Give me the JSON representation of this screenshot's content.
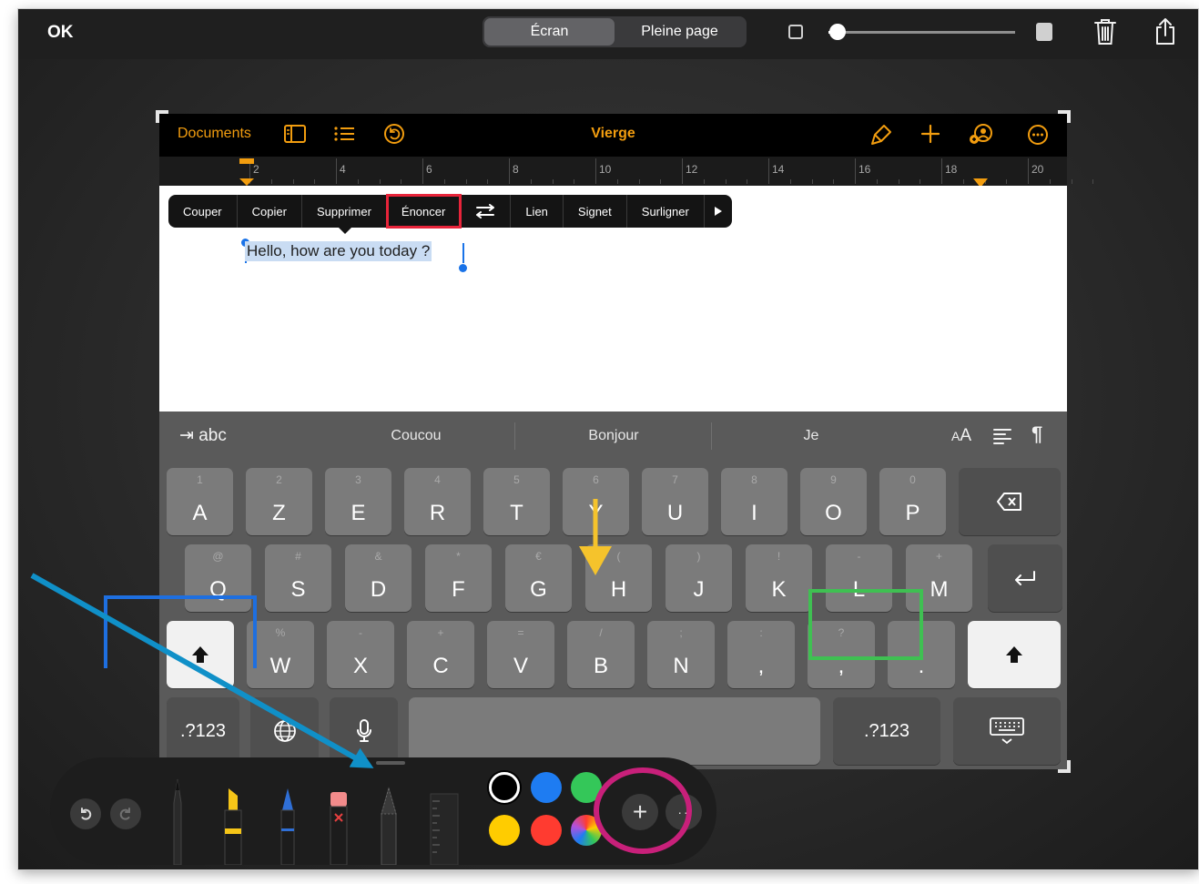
{
  "topbar": {
    "ok_label": "OK",
    "segments": [
      {
        "label": "Écran",
        "active": true
      },
      {
        "label": "Pleine page",
        "active": false
      }
    ],
    "line_width_level": 0.05,
    "icons": [
      "square-small-icon",
      "square-large-icon",
      "trash-icon",
      "share-icon"
    ]
  },
  "pages": {
    "documents_label": "Documents",
    "title": "Vierge",
    "accent_color": "#f29d0f",
    "icons": [
      "sidebar-icon",
      "list-icon",
      "undo-circle-icon",
      "paintbrush-icon",
      "plus-icon",
      "collaborate-icon",
      "more-circle-icon"
    ],
    "ruler_numbers": [
      "2",
      "4",
      "6",
      "8",
      "10",
      "12",
      "14",
      "16",
      "18",
      "20"
    ]
  },
  "context_menu": {
    "items": [
      "Couper",
      "Copier",
      "Supprimer",
      "Énoncer",
      "",
      "Lien",
      "Signet",
      "Surligner"
    ],
    "highlighted": "Énoncer"
  },
  "document": {
    "selected_text": "Hello, how are you today ?"
  },
  "keyboard": {
    "tab_label": "abc",
    "predictions": [
      "Coucou",
      "Bonjour",
      "Je"
    ],
    "format_label": "AA",
    "pilcrow": "¶",
    "row1": [
      {
        "sub": "1",
        "main": "A"
      },
      {
        "sub": "2",
        "main": "Z"
      },
      {
        "sub": "3",
        "main": "E"
      },
      {
        "sub": "4",
        "main": "R"
      },
      {
        "sub": "5",
        "main": "T"
      },
      {
        "sub": "6",
        "main": "Y"
      },
      {
        "sub": "7",
        "main": "U"
      },
      {
        "sub": "8",
        "main": "I"
      },
      {
        "sub": "9",
        "main": "O"
      },
      {
        "sub": "0",
        "main": "P"
      }
    ],
    "row2": [
      {
        "sub": "@",
        "main": "Q"
      },
      {
        "sub": "#",
        "main": "S"
      },
      {
        "sub": "&",
        "main": "D"
      },
      {
        "sub": "*",
        "main": "F"
      },
      {
        "sub": "€",
        "main": "G"
      },
      {
        "sub": "(",
        "main": "H"
      },
      {
        "sub": ")",
        "main": "J"
      },
      {
        "sub": "!",
        "main": "K"
      },
      {
        "sub": "-",
        "main": "L"
      },
      {
        "sub": "+",
        "main": "M"
      }
    ],
    "row3": [
      {
        "sub": "%",
        "main": "W"
      },
      {
        "sub": "-",
        "main": "X"
      },
      {
        "sub": "+",
        "main": "C"
      },
      {
        "sub": "=",
        "main": "V"
      },
      {
        "sub": "/",
        "main": "B"
      },
      {
        "sub": ";",
        "main": "N"
      },
      {
        "sub": ":",
        "main": ","
      },
      {
        "sub": "?",
        "main": ","
      },
      {
        "sub": "'",
        "main": "."
      }
    ],
    "numbers_label": ".?123",
    "icons": [
      "delete-icon",
      "return-icon",
      "shift-icon",
      "globe-icon",
      "microphone-icon",
      "keyboard-dismiss-icon"
    ]
  },
  "palette": {
    "colors": [
      "#000000",
      "#1e7cf2",
      "#34c759",
      "#ffcc00",
      "#ff3b30"
    ],
    "tools": [
      "pen-tool-icon",
      "marker-tool-icon",
      "pencil-tool-icon",
      "eraser-tool-icon",
      "lasso-tool-icon",
      "ruler-tool-icon"
    ],
    "plus_label": "+"
  }
}
